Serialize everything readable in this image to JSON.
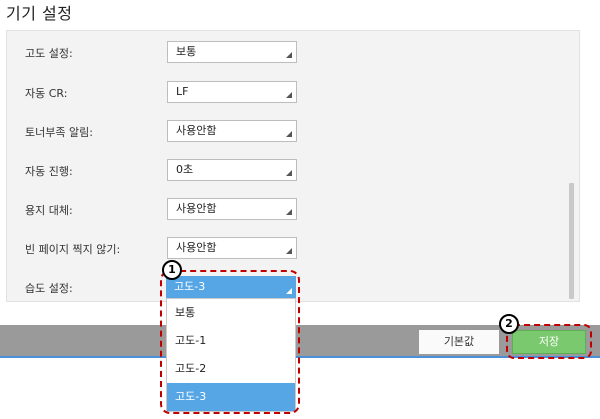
{
  "page": {
    "title": "기기 설정"
  },
  "settings": [
    {
      "label": "고도 설정:",
      "value": "보통"
    },
    {
      "label": "자동 CR:",
      "value": "LF"
    },
    {
      "label": "토너부족 알림:",
      "value": "사용안함"
    },
    {
      "label": "자동 진행:",
      "value": "0초"
    },
    {
      "label": "용지 대체:",
      "value": "사용안함"
    },
    {
      "label": "빈 페이지 찍지 않기:",
      "value": "사용안함"
    },
    {
      "label": "습도 설정:",
      "value": "고도-3"
    }
  ],
  "dropdown": {
    "options": [
      "보통",
      "고도-1",
      "고도-2",
      "고도-3"
    ],
    "selected": "고도-3"
  },
  "footer": {
    "default_label": "기본값",
    "save_label": "저장"
  },
  "callouts": {
    "one": "1",
    "two": "2"
  },
  "colors": {
    "accent_blue": "#56a6e6",
    "save_green": "#7bc96f",
    "highlight_red": "#c00000",
    "footer_gray": "#9a9a9a"
  }
}
